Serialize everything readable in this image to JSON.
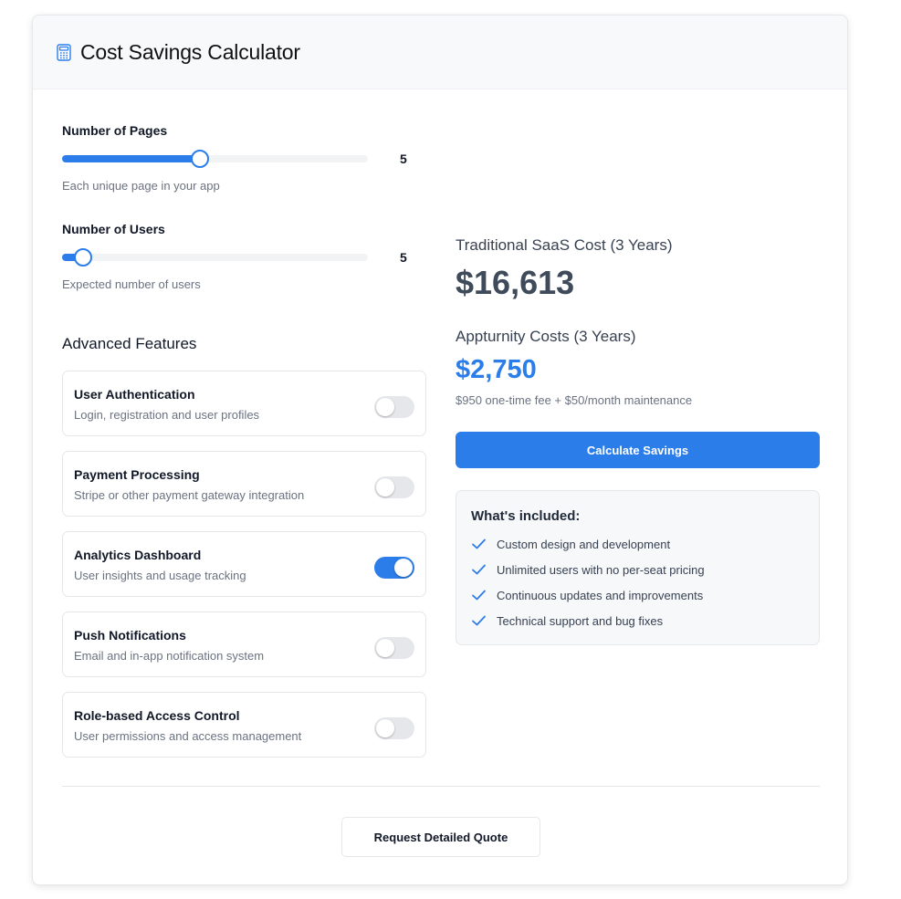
{
  "header": {
    "icon": "calculator-icon",
    "title": "Cost Savings Calculator"
  },
  "sliders": {
    "pages": {
      "label": "Number of Pages",
      "value": "5",
      "help": "Each unique page in your app",
      "fill_fraction": 0.45
    },
    "users": {
      "label": "Number of Users",
      "value": "5",
      "help": "Expected number of users",
      "fill_fraction": 0.07
    }
  },
  "features": {
    "title": "Advanced Features",
    "items": [
      {
        "name": "User Authentication",
        "description": "Login, registration and user profiles",
        "enabled": false
      },
      {
        "name": "Payment Processing",
        "description": "Stripe or other payment gateway integration",
        "enabled": false
      },
      {
        "name": "Analytics Dashboard",
        "description": "User insights and usage tracking",
        "enabled": true
      },
      {
        "name": "Push Notifications",
        "description": "Email and in-app notification system",
        "enabled": false
      },
      {
        "name": "Role-based Access Control",
        "description": "User permissions and access management",
        "enabled": false
      }
    ]
  },
  "costs": {
    "traditional_label": "Traditional SaaS Cost (3 Years)",
    "traditional_value": "$16,613",
    "appturnity_label": "Appturnity Costs (3 Years)",
    "appturnity_value": "$2,750",
    "appturnity_note": "$950 one-time fee + $50/month maintenance"
  },
  "calculate_button": "Calculate Savings",
  "included": {
    "title": "What's included:",
    "items": [
      "Custom design and development",
      "Unlimited users with no per-seat pricing",
      "Continuous updates and improvements",
      "Technical support and bug fixes"
    ]
  },
  "quote_button": "Request Detailed Quote",
  "colors": {
    "accent": "#2b7de9",
    "muted_text": "#6b7280",
    "big_number": "#3f4a5a"
  }
}
